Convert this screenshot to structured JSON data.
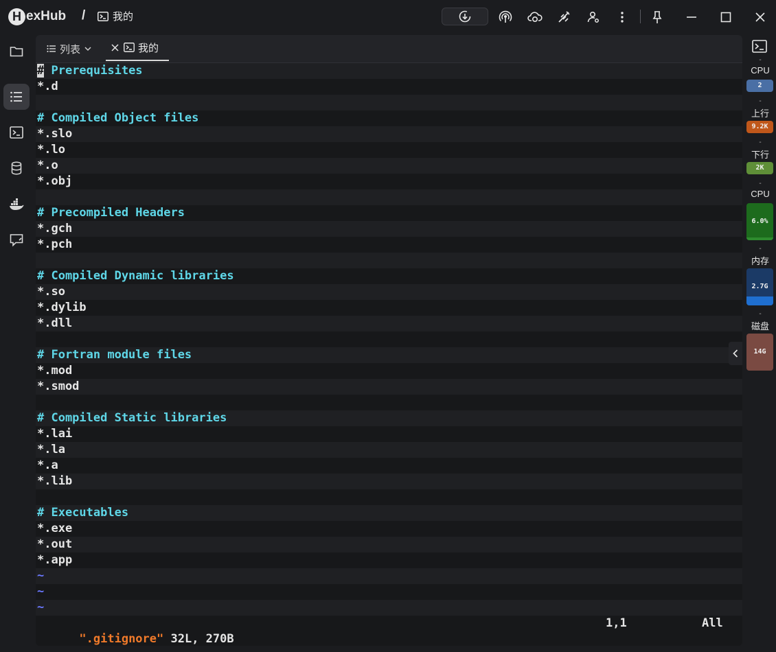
{
  "app": {
    "logo_letter": "H",
    "logo_rest": "exHub",
    "breadcrumb_sep": "/",
    "breadcrumb_current": "我的"
  },
  "tabs": {
    "list_label": "列表",
    "active_label": "我的"
  },
  "editor": {
    "lines": [
      {
        "type": "comment",
        "text": "# Prerequisites"
      },
      {
        "type": "normal",
        "text": "*.d"
      },
      {
        "type": "normal",
        "text": ""
      },
      {
        "type": "comment",
        "text": "# Compiled Object files"
      },
      {
        "type": "normal",
        "text": "*.slo"
      },
      {
        "type": "normal",
        "text": "*.lo"
      },
      {
        "type": "normal",
        "text": "*.o"
      },
      {
        "type": "normal",
        "text": "*.obj"
      },
      {
        "type": "normal",
        "text": ""
      },
      {
        "type": "comment",
        "text": "# Precompiled Headers"
      },
      {
        "type": "normal",
        "text": "*.gch"
      },
      {
        "type": "normal",
        "text": "*.pch"
      },
      {
        "type": "normal",
        "text": ""
      },
      {
        "type": "comment",
        "text": "# Compiled Dynamic libraries"
      },
      {
        "type": "normal",
        "text": "*.so"
      },
      {
        "type": "normal",
        "text": "*.dylib"
      },
      {
        "type": "normal",
        "text": "*.dll"
      },
      {
        "type": "normal",
        "text": ""
      },
      {
        "type": "comment",
        "text": "# Fortran module files"
      },
      {
        "type": "normal",
        "text": "*.mod"
      },
      {
        "type": "normal",
        "text": "*.smod"
      },
      {
        "type": "normal",
        "text": ""
      },
      {
        "type": "comment",
        "text": "# Compiled Static libraries"
      },
      {
        "type": "normal",
        "text": "*.lai"
      },
      {
        "type": "normal",
        "text": "*.la"
      },
      {
        "type": "normal",
        "text": "*.a"
      },
      {
        "type": "normal",
        "text": "*.lib"
      },
      {
        "type": "normal",
        "text": ""
      },
      {
        "type": "comment",
        "text": "# Executables"
      },
      {
        "type": "normal",
        "text": "*.exe"
      },
      {
        "type": "normal",
        "text": "*.out"
      },
      {
        "type": "normal",
        "text": "*.app"
      },
      {
        "type": "tilde",
        "text": "~"
      },
      {
        "type": "tilde",
        "text": "~"
      },
      {
        "type": "tilde",
        "text": "~"
      }
    ],
    "status": {
      "filename": "\".gitignore\"",
      "info": " 32L, 270B",
      "position": "1,1",
      "scroll": "All"
    }
  },
  "monitor": {
    "dash": "-",
    "cpu_cores_label": "CPU",
    "cpu_cores_value": "2",
    "upload_label": "上行",
    "upload_value": "9.2K",
    "download_label": "下行",
    "download_value": "2K",
    "cpu_usage_label": "CPU",
    "cpu_usage_value": "6.0%",
    "cpu_usage_level": 0.06,
    "memory_label": "内存",
    "memory_value": "2.7G",
    "memory_level": 0.25,
    "disk_label": "磁盘",
    "disk_value": "14G",
    "colors": {
      "cpu_cores": "#4a6fa5",
      "upload": "#c0571a",
      "download": "#5f8f38",
      "cpu_usage": "#2e8b2e",
      "memory": "#1f6fd0",
      "disk": "#7a4a42"
    }
  }
}
